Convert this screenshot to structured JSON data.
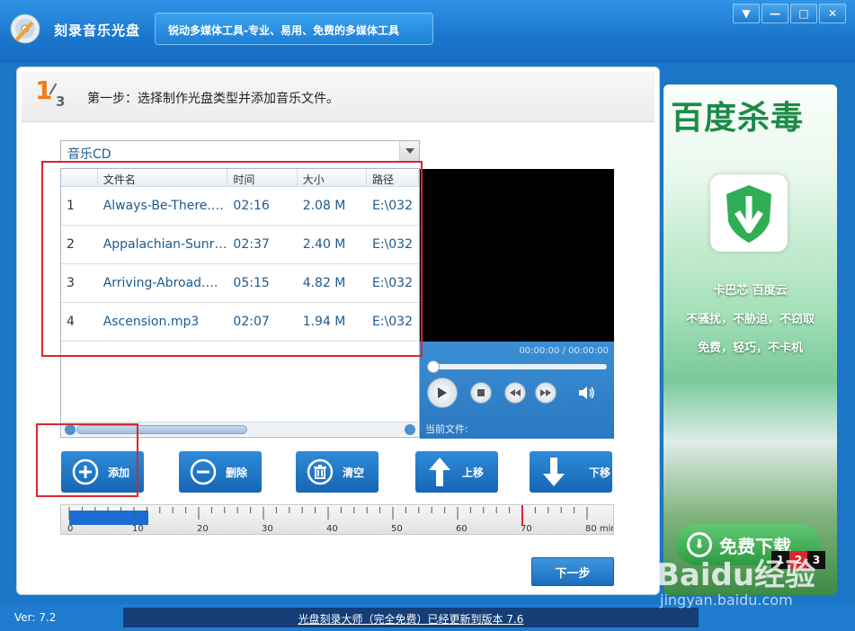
{
  "titlebar": {
    "app_title": "刻录音乐光盘",
    "slogan": "锐动多媒体工具-专业、易用、免费的多媒体工具"
  },
  "window_controls": [
    "▼",
    "—",
    "□",
    "✕"
  ],
  "step": {
    "current": "1",
    "total": "3",
    "text": "第一步：选择制作光盘类型并添加音乐文件。"
  },
  "disc_type": {
    "selected": "音乐CD"
  },
  "file_table": {
    "headers": [
      "",
      "文件名",
      "时间",
      "大小",
      "路径"
    ],
    "rows": [
      [
        "1",
        "Always-Be-There.mp3",
        "02:16",
        "2.08 M",
        "E:\\032"
      ],
      [
        "2",
        "Appalachian-Sunrise...",
        "02:37",
        "2.40 M",
        "E:\\032"
      ],
      [
        "3",
        "Arriving-Abroad.mp3",
        "05:15",
        "4.82 M",
        "E:\\032"
      ],
      [
        "4",
        "Ascension.mp3",
        "02:07",
        "1.94 M",
        "E:\\032"
      ]
    ]
  },
  "player": {
    "time": "00:00:00 / 00:00:00",
    "current_file_label": "当前文件:"
  },
  "actions": {
    "add": "添加",
    "delete": "删除",
    "clear": "清空",
    "move_up": "上移",
    "move_down": "下移"
  },
  "capacity": {
    "ticks": [
      "0",
      "10",
      "20",
      "30",
      "40",
      "50",
      "60",
      "70",
      "80 min"
    ],
    "used_minutes": 12.25,
    "limit_minutes": 70
  },
  "next_button": "下一步",
  "ad": {
    "title": "百度杀毒",
    "line1": "卡巴芯  百度云",
    "line2": "不骚扰，不胁迫，不窃取",
    "line3": "免费，轻巧，不卡机",
    "download": "免费下载",
    "pages": [
      "1",
      "2",
      "3"
    ],
    "active_page": "2"
  },
  "status": {
    "version": "Ver: 7.2",
    "notice": "光盘刻录大师（完全免费）已经更新到版本 7.6"
  },
  "watermark": {
    "brand": "Baidu经验",
    "url": "jingyan.baidu.com"
  },
  "colors": {
    "titlebar_blue": "#1a76cc",
    "button_blue": "#1f78c9",
    "highlight_red": "#d9272e",
    "step_orange": "#f27b1a",
    "ad_green": "#1d8a47"
  }
}
